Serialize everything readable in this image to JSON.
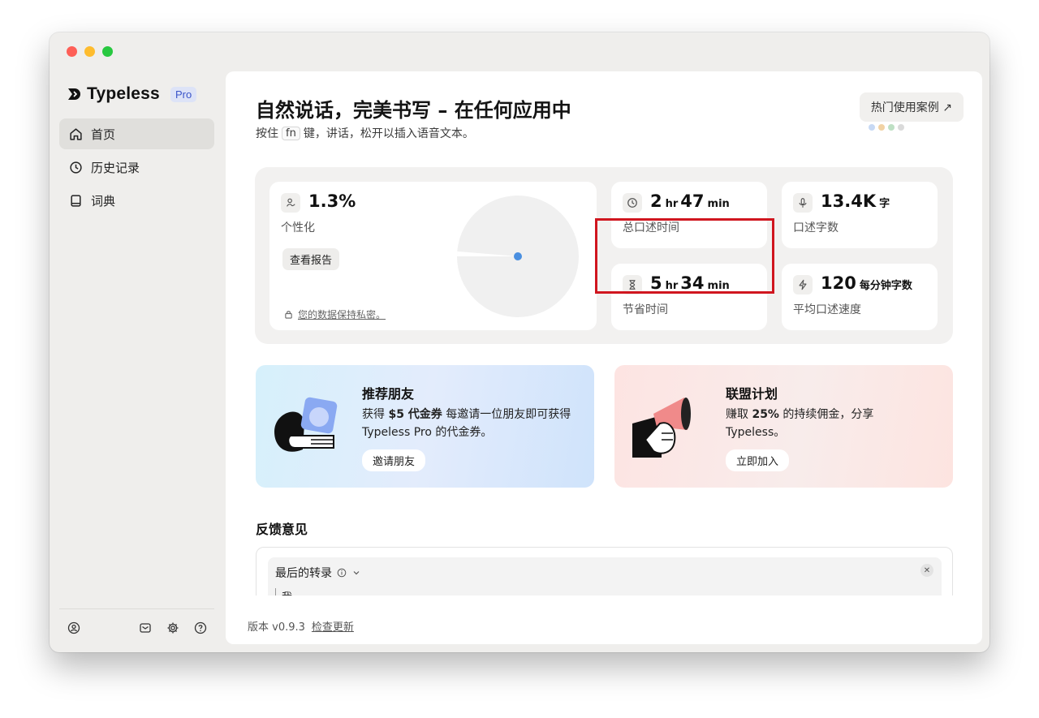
{
  "app": {
    "brand": "Typeless",
    "badge": "Pro"
  },
  "sidebar": {
    "items": [
      {
        "label": "首页",
        "icon": "home-icon",
        "active": true
      },
      {
        "label": "历史记录",
        "icon": "history-icon",
        "active": false
      },
      {
        "label": "词典",
        "icon": "book-icon",
        "active": false
      }
    ],
    "bottom_icons": [
      "account-icon",
      "mail-icon",
      "settings-icon",
      "help-icon"
    ]
  },
  "header": {
    "title": "自然说话，完美书写 – 在任何应用中",
    "subtitle_before": "按住",
    "key": "fn",
    "subtitle_after": "键，讲话，松开以插入语音文本。",
    "cases_button": "热门使用案例 ↗"
  },
  "stats": {
    "personalization": {
      "value": "1.3%",
      "label": "个性化",
      "report_button": "查看报告",
      "privacy_text": "您的数据保持私密。",
      "pie_fraction": 0.013,
      "icon": "signature-icon"
    },
    "total_time": {
      "hours": "2",
      "hours_unit": "hr",
      "minutes": "47",
      "minutes_unit": "min",
      "label": "总口述时间",
      "icon": "clock-icon"
    },
    "word_count": {
      "value": "13.4K",
      "unit": "字",
      "label": "口述字数",
      "icon": "microphone-icon"
    },
    "saved_time": {
      "hours": "5",
      "hours_unit": "hr",
      "minutes": "34",
      "minutes_unit": "min",
      "label": "节省时间",
      "icon": "hourglass-icon"
    },
    "speed": {
      "value": "120",
      "unit": "每分钟字数",
      "label": "平均口述速度",
      "icon": "lightning-icon"
    }
  },
  "promos": {
    "referral": {
      "title": "推荐朋友",
      "text_prefix": "获得 ",
      "text_bold": "$5 代金券",
      "text_suffix": " 每邀请一位朋友即可获得 Typeless Pro 的代金券。",
      "button": "邀请朋友"
    },
    "affiliate": {
      "title": "联盟计划",
      "text_prefix": "赚取 ",
      "text_bold": "25%",
      "text_suffix": " 的持续佣金，分享 Typeless。",
      "button": "立即加入"
    }
  },
  "feedback": {
    "title": "反馈意见",
    "last_transcript_label": "最后的转录",
    "transcript_text": "我"
  },
  "footer": {
    "version": "版本 v0.9.3",
    "check_update": "检查更新"
  },
  "colors": {
    "highlight_border": "#d0161f",
    "pro_badge_bg": "#dde3f7",
    "pro_badge_text": "#3b55c9",
    "pie_marker": "#4a8fe0"
  }
}
